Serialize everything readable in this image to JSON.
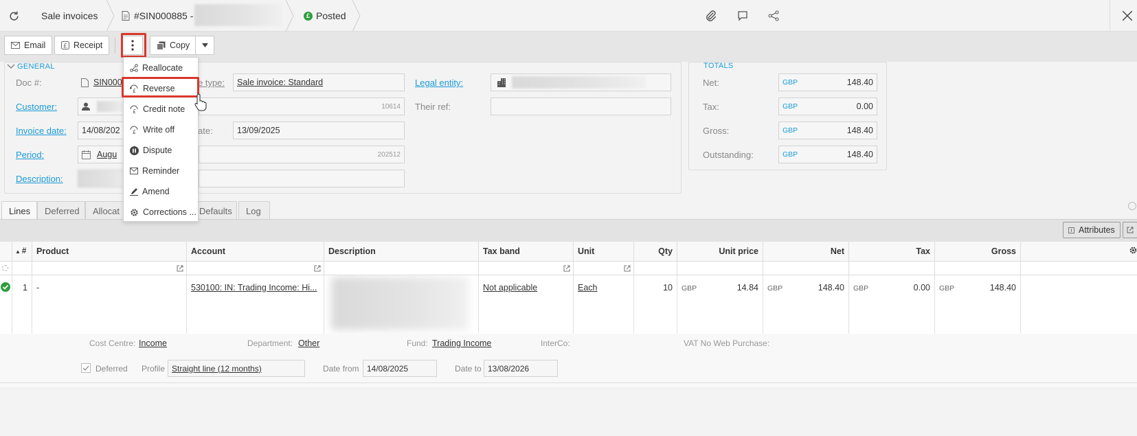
{
  "topbar": {
    "title": "Sale invoices",
    "doc_ref": "#SIN000885 -",
    "status": "Posted"
  },
  "toolbar": {
    "email": "Email",
    "receipt": "Receipt",
    "copy": "Copy"
  },
  "menu": {
    "items": [
      "Reallocate",
      "Reverse",
      "Credit note",
      "Write off",
      "Dispute",
      "Reminder",
      "Amend",
      "Corrections ..."
    ]
  },
  "general": {
    "section": "GENERAL",
    "doc_label": "Doc #:",
    "doc_value": "SIN0008",
    "customer_label": "Customer:",
    "customer_code": "10614",
    "invoice_date_label": "Invoice date:",
    "invoice_date": "14/08/202",
    "period_label": "Period:",
    "period_value": "Augu",
    "period_code": "202512",
    "description_label": "Description:",
    "type_label": "e type:",
    "type_value": "Sale invoice: Standard",
    "due_label": "ate:",
    "due_value": "13/09/2025",
    "legal_label": "Legal entity:",
    "their_ref_label": "Their ref:"
  },
  "totals": {
    "section": "TOTALS",
    "currency": "GBP",
    "rows": [
      {
        "label": "Net:",
        "value": "148.40"
      },
      {
        "label": "Tax:",
        "value": "0.00"
      },
      {
        "label": "Gross:",
        "value": "148.40"
      },
      {
        "label": "Outstanding:",
        "value": "148.40"
      }
    ]
  },
  "tabs": [
    "Lines",
    "Deferred",
    "Allocat",
    "Defaults",
    "Log"
  ],
  "grid": {
    "attributes_label": "Attributes",
    "headers": {
      "num": "#",
      "product": "Product",
      "account": "Account",
      "description": "Description",
      "tax_band": "Tax band",
      "unit": "Unit",
      "qty": "Qty",
      "unit_price": "Unit price",
      "net": "Net",
      "tax": "Tax",
      "gross": "Gross"
    },
    "row": {
      "num": "1",
      "product": "-",
      "account": "530100: IN: Trading Income: Hi...",
      "tax_band": "Not applicable",
      "unit": "Each",
      "qty": "10",
      "currency": "GBP",
      "unit_price": "14.84",
      "net": "148.40",
      "tax": "0.00",
      "gross": "148.40"
    },
    "detail": {
      "cost_centre_label": "Cost Centre:",
      "cost_centre": "Income",
      "department_label": "Department:",
      "department": "Other",
      "fund_label": "Fund:",
      "fund": "Trading Income",
      "interco_label": "InterCo:",
      "vat_label": "VAT No Web Purchase:",
      "deferred_label": "Deferred",
      "profile_label": "Profile",
      "profile": "Straight line (12 months)",
      "date_from_label": "Date from",
      "date_from": "14/08/2025",
      "date_to_label": "Date to",
      "date_to": "13/08/2026"
    }
  },
  "colors": {
    "accent": "#1a9bd7",
    "highlight": "#d9372a",
    "posted": "#2e9e3e"
  }
}
